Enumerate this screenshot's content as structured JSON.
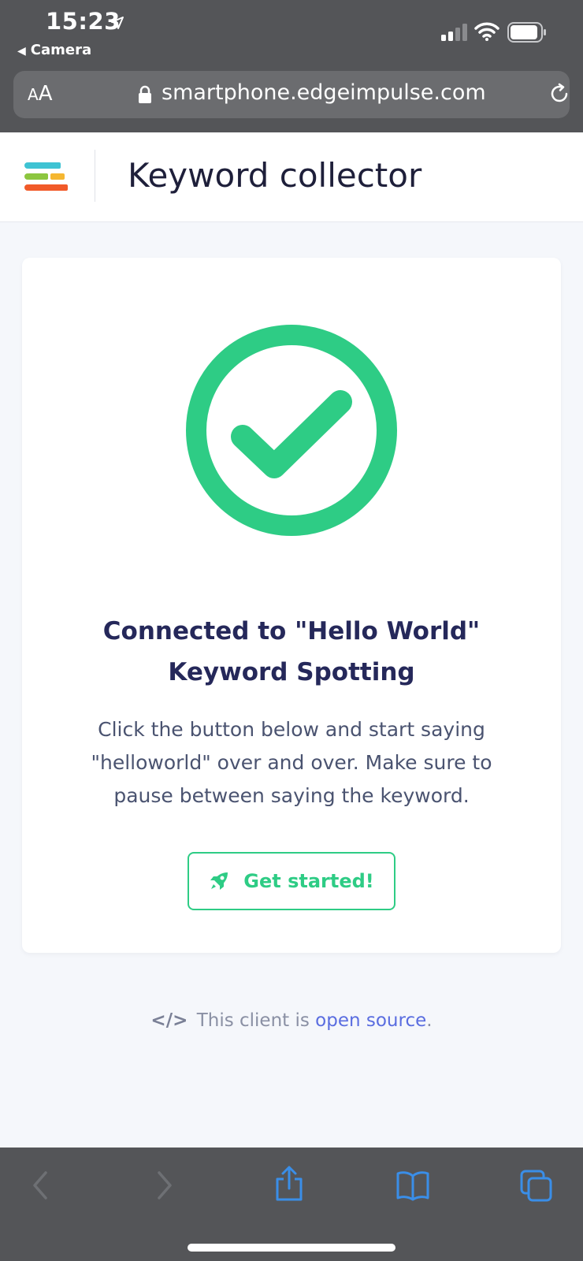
{
  "status_bar": {
    "time": "15:23",
    "back_app": "Camera"
  },
  "browser": {
    "text_size_small": "A",
    "text_size_big": "A",
    "url": "smartphone.edgeimpulse.com"
  },
  "header": {
    "title": "Keyword collector"
  },
  "card": {
    "heading_line1": "Connected to \"Hello World\"",
    "heading_line2": "Keyword Spotting",
    "desc_line1": "Click the button below and start saying",
    "desc_line2": "\"helloworld\" over and over. Make sure to",
    "desc_line3": "pause between saying the keyword.",
    "button_label": "Get started!"
  },
  "footer": {
    "code_icon": "</>",
    "prefix": "This client is",
    "link": "open source",
    "suffix": "."
  },
  "icons": {
    "location": "location-arrow-icon",
    "signal": "cell-signal-icon",
    "wifi": "wifi-icon",
    "battery": "battery-icon",
    "lock": "lock-icon",
    "reload": "reload-icon",
    "logo": "edge-impulse-logo",
    "check": "check-circle-icon",
    "rocket": "rocket-icon",
    "back": "chevron-left-icon",
    "forward": "chevron-right-icon",
    "share": "share-icon",
    "bookmarks": "book-icon",
    "tabs": "tabs-icon"
  },
  "colors": {
    "accent_green": "#2ecc85",
    "heading": "#25285a",
    "link": "#5a6de0",
    "chrome": "#545558",
    "toolbar_icons": "#3a8ee8"
  }
}
